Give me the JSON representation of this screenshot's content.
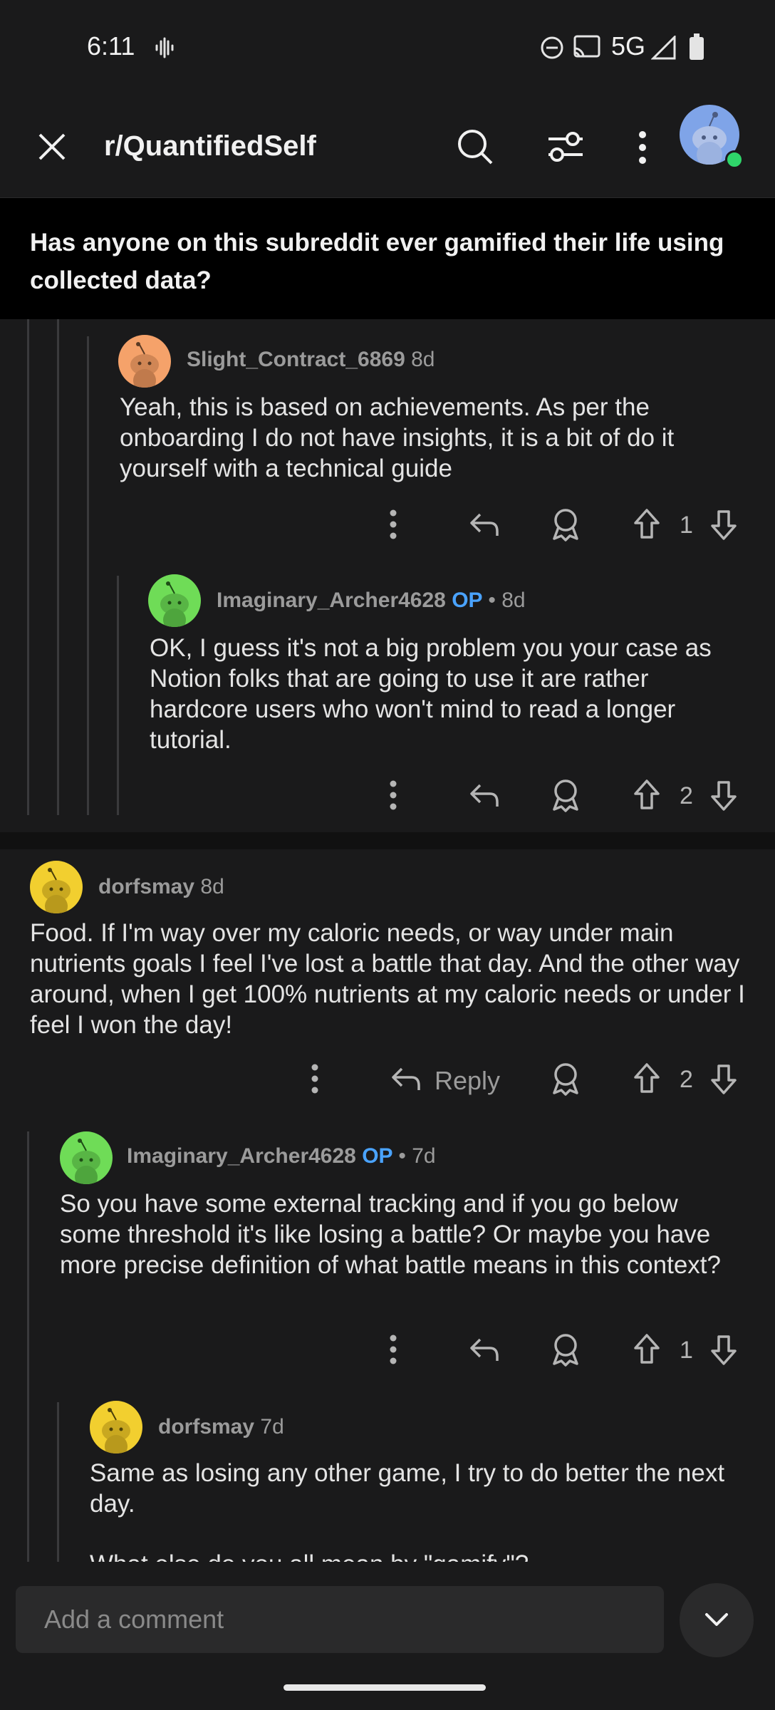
{
  "status_bar": {
    "time": "6:11",
    "network": "5G"
  },
  "header": {
    "subreddit": "r/QuantifiedSelf"
  },
  "post": {
    "title": "Has anyone on this subreddit ever gamified their life using collected data?"
  },
  "comments": [
    {
      "username": "Slight_Contract_6869",
      "age": "8d",
      "op": "",
      "body": "Yeah, this is based on achievements. As per the onboarding I do not have insights, it is a bit of do it yourself with a technical guide",
      "votes": "1",
      "avatar_color": "#f5a26a"
    },
    {
      "username": "Imaginary_Archer4628",
      "age": "8d",
      "op": "OP",
      "sep": "•",
      "body": "OK, I guess it's not a big problem you your case as Notion folks that are going to use it are rather hardcore users who won't mind to read a longer tutorial.",
      "votes": "2",
      "avatar_color": "#6fdc57"
    },
    {
      "username": "dorfsmay",
      "age": "8d",
      "op": "",
      "body": "Food. If I'm way over my caloric needs, or way under main nutrients goals I feel I've lost a battle that day. And the other way around, when I get 100% nutrients at my caloric needs or under I feel I won the day!",
      "votes": "2",
      "reply_label": "Reply",
      "avatar_color": "#f2cf2f"
    },
    {
      "username": "Imaginary_Archer4628",
      "age": "7d",
      "op": "OP",
      "sep": "•",
      "body": "So you have some external tracking and if you go below some threshold it's like losing a battle? Or maybe you have more precise definition of what battle means in this context?",
      "votes": "1",
      "avatar_color": "#6fdc57"
    },
    {
      "username": "dorfsmay",
      "age": "7d",
      "op": "",
      "body": "Same as losing any other game, I try to do better the next day.",
      "body2": "What else do you all mean by \"gamify\"?",
      "avatar_color": "#f2cf2f"
    }
  ],
  "composer": {
    "placeholder": "Add a comment"
  },
  "colors": {
    "background": "#1a1a1b",
    "op_badge": "#4aa3ff",
    "text": "#e4e4e4"
  }
}
